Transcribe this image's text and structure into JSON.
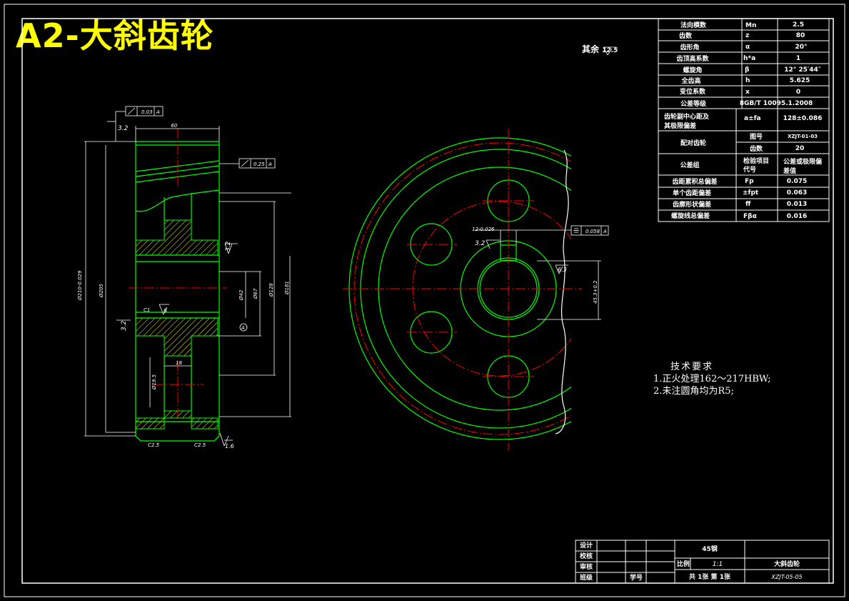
{
  "title": "A2-大斜齿轮",
  "roughness_other": {
    "label": "其余",
    "value": "12.5"
  },
  "param_table": {
    "rows": [
      {
        "name": "法向模数",
        "symbol": "Mn",
        "value": "2.5"
      },
      {
        "name": "齿数",
        "symbol": "z",
        "value": "80"
      },
      {
        "name": "齿形角",
        "symbol": "α",
        "value": "20°"
      },
      {
        "name": "齿顶高系数",
        "symbol": "h*a",
        "value": "1"
      },
      {
        "name": "螺旋角",
        "symbol": "β",
        "value": "12° 25′44″"
      },
      {
        "name": "全齿高",
        "symbol": "h",
        "value": "5.625"
      },
      {
        "name": "变位系数",
        "symbol": "x",
        "value": "0"
      }
    ],
    "accuracy": {
      "name": "公差等级",
      "value": "8GB/T 10095.1.2008"
    },
    "center": {
      "name1": "齿轮副中心距及",
      "name2": "其极限偏差",
      "symbol": "a±fa",
      "value": "128±0.086"
    },
    "mating": {
      "name": "配对齿轮",
      "r1_label": "图号",
      "r1_value": "XZJT-01-03",
      "r2_label": "齿数",
      "r2_value": "20"
    },
    "group": {
      "name": "公差组",
      "c2a": "检验项目",
      "c2b": "代号",
      "c3a": "公差或极限偏",
      "c3b": "差值"
    },
    "tol": [
      {
        "name": "齿距累积总偏差",
        "symbol": "Fp",
        "value": "0.075"
      },
      {
        "name": "单个齿距偏差",
        "symbol": "±fpt",
        "value": "0.063"
      },
      {
        "name": "齿廓形状偏差",
        "symbol": "ff",
        "value": "0.013"
      },
      {
        "name": "螺旋线总偏差",
        "symbol": "Fβα",
        "value": "0.016"
      }
    ]
  },
  "tech_requirements": {
    "title": "技术要求",
    "items": [
      "1.正火处理162～217HBW;",
      "2.未注圆角均为R5;"
    ]
  },
  "title_block": {
    "roles": [
      "设计",
      "校核",
      "审核",
      "班级"
    ],
    "student_no": "学号",
    "material": "45钢",
    "scale_label": "比例",
    "scale_value": "1:1",
    "part_name": "大斜齿轮",
    "sheets": "共 1张 第 1张",
    "drawing_no": "XZJT-05-05"
  },
  "left_view": {
    "dim_width": "60",
    "runout_top": "0.03",
    "runout_mid": "0.25",
    "datum": "A",
    "rough_top": "3.2",
    "rough_bore": "3.2",
    "rough_hub": "3.2",
    "rough_mid": "6",
    "rough_bottom": "1.6",
    "dia_tip": "Ø210-0.029",
    "dia_root": "Ø205",
    "dia_bore": "Ø42",
    "dia_hub": "Ø67",
    "dia_holes": "Ø128",
    "dia_rim": "Ø181",
    "dia_web": "Ø19.5",
    "web_thk": "18",
    "chamfer_l": "C1",
    "chamfer_b1": "C2.5",
    "chamfer_b2": "C2.5",
    "datum_circle": "A"
  },
  "right_view": {
    "key_tol": "12-0.026",
    "key_rough": "3.2",
    "symmetry": "0.058",
    "datum": "A",
    "keyway_depth": "45.3+0.2",
    "rough_key": "6.3"
  },
  "colors": {
    "green": "#00ff00",
    "red": "#ff0000",
    "white": "#ffffff",
    "yellow": "#ffff00",
    "hatch": "#ffff00"
  }
}
